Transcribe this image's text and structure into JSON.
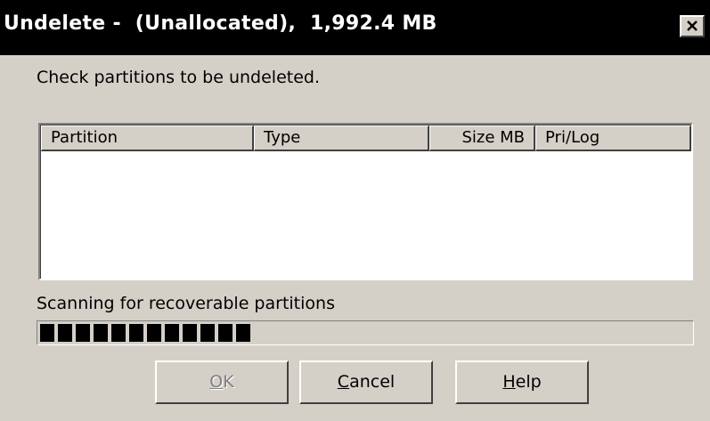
{
  "window": {
    "title": "Undelete -  (Unallocated),  1,992.4 MB"
  },
  "instruction": "Check partitions to be undeleted.",
  "partition_list": {
    "columns": [
      "Partition",
      "Type",
      "Size MB",
      "Pri/Log"
    ],
    "rows": []
  },
  "status": {
    "label": "Scanning for recoverable partitions",
    "progress_blocks_filled": 12
  },
  "buttons": {
    "ok": {
      "mnemonic": "O",
      "rest": "K",
      "enabled": false
    },
    "cancel": {
      "mnemonic": "C",
      "rest": "ancel",
      "enabled": true
    },
    "help": {
      "mnemonic": "H",
      "rest": "elp",
      "enabled": true
    }
  },
  "icons": {
    "close": "close-icon"
  }
}
